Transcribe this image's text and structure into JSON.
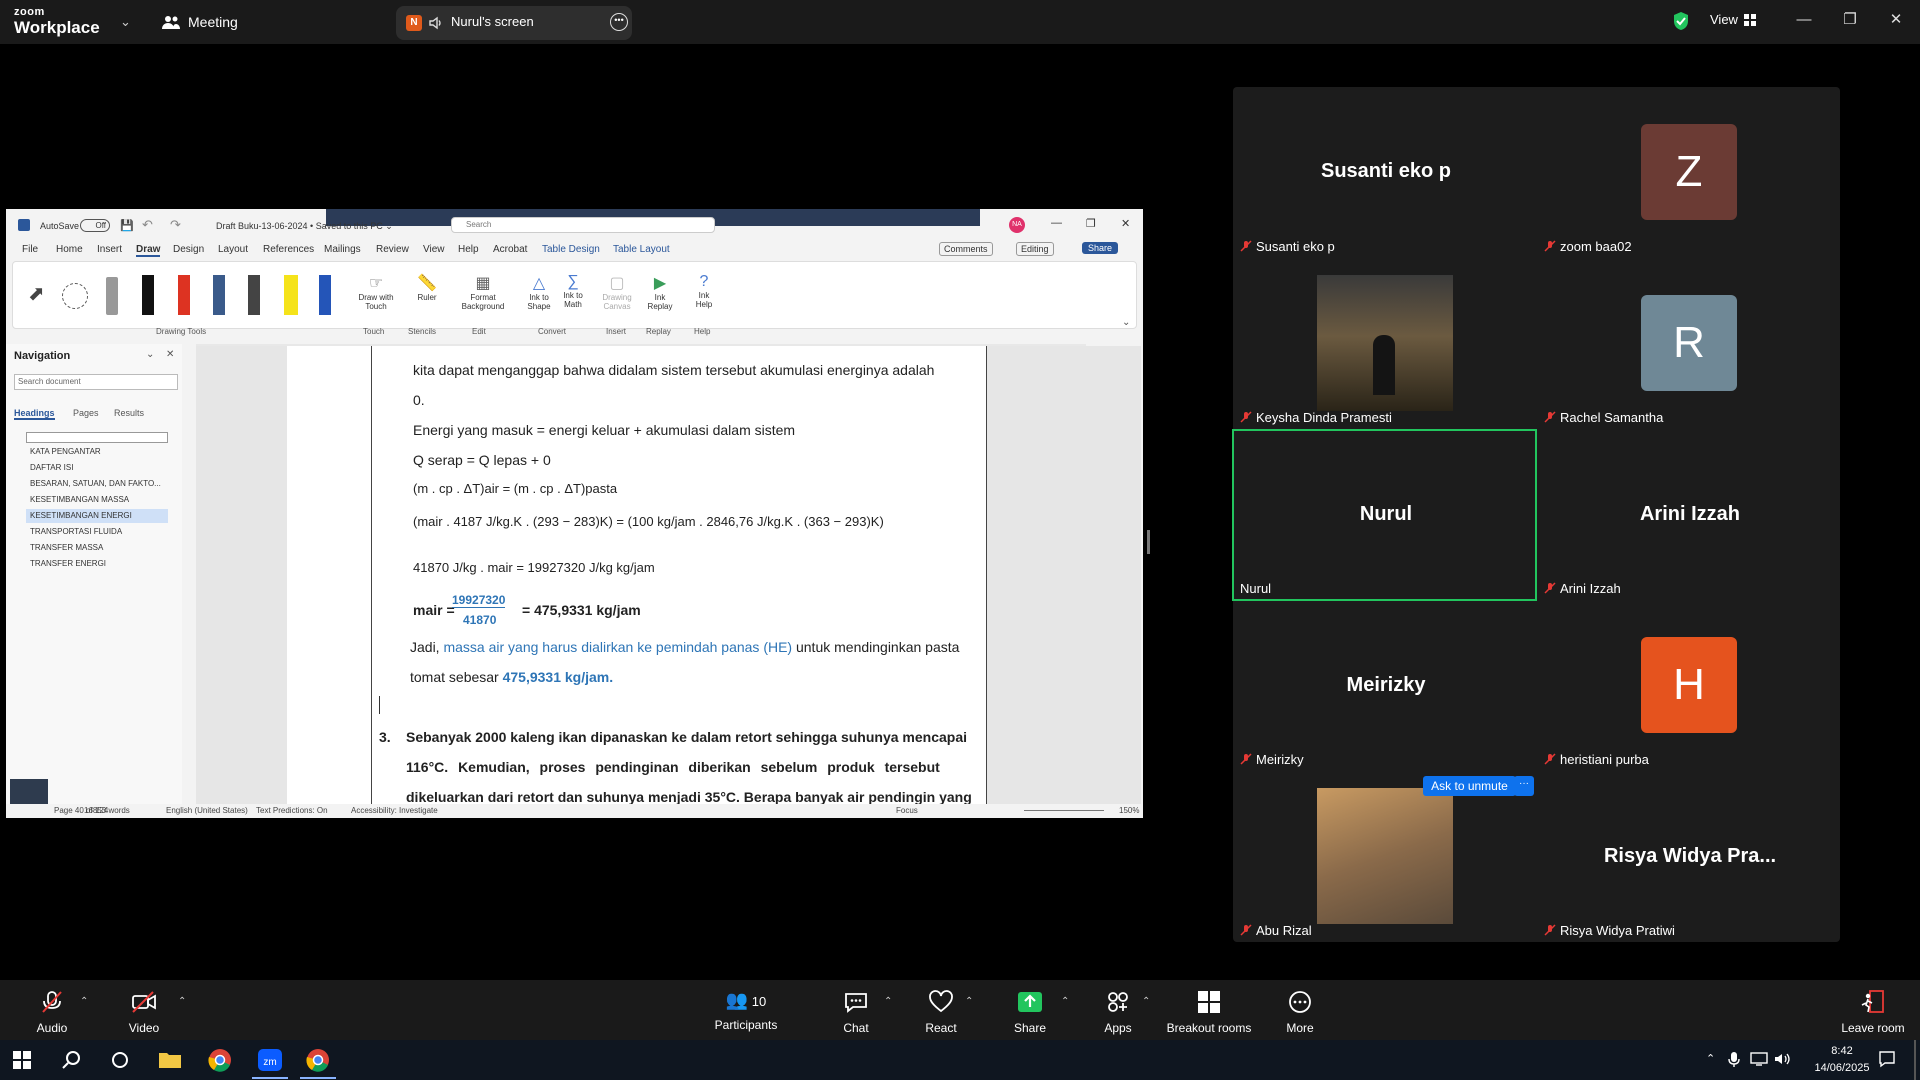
{
  "app": {
    "brand_top": "zoom",
    "brand_bottom": "Workplace",
    "meeting_label": "Meeting",
    "view_label": "View"
  },
  "share_pill": {
    "initial": "N",
    "label": "Nurul's screen"
  },
  "word": {
    "autosave_label": "AutoSave",
    "autosave_state": "Off",
    "doc_title": "Draft Buku-13-06-2024 • Saved to this PC ⌄",
    "search_placeholder": "Search",
    "user_initials": "NA",
    "tabs": [
      "File",
      "Home",
      "Insert",
      "Draw",
      "Design",
      "Layout",
      "References",
      "Mailings",
      "Review",
      "View",
      "Help",
      "Acrobat",
      "Table Design",
      "Table Layout"
    ],
    "comments_label": "Comments",
    "editing_label": "Editing",
    "share_label": "Share",
    "ribbon_groups": [
      {
        "label": "Drawing Tools"
      },
      {
        "label": "Touch",
        "items": [
          "Draw with\nTouch"
        ]
      },
      {
        "label": "Stencils",
        "items": [
          "Ruler"
        ]
      },
      {
        "label": "Edit",
        "items": [
          "Format\nBackground"
        ]
      },
      {
        "label": "Convert",
        "items": [
          "Ink to\nShape",
          "Ink to\nMath"
        ]
      },
      {
        "label": "Insert",
        "items": [
          "Drawing\nCanvas"
        ]
      },
      {
        "label": "Replay",
        "items": [
          "Ink\nReplay"
        ]
      },
      {
        "label": "Help",
        "items": [
          "Ink\nHelp"
        ]
      }
    ],
    "nav": {
      "title": "Navigation",
      "search_placeholder": "Search document",
      "tabs": [
        "Headings",
        "Pages",
        "Results"
      ],
      "items": [
        "KATA PENGANTAR",
        "DAFTAR ISI",
        "BESARAN, SATUAN, DAN FAKTO...",
        "KESETIMBANGAN MASSA",
        "KESETIMBANGAN ENERGI",
        "TRANSPORTASI FLUIDA",
        "TRANSFER MASSA",
        "TRANSFER ENERGI"
      ]
    },
    "body": {
      "line1": "kita dapat menganggap bahwa didalam sistem tersebut akumulasi energinya adalah",
      "line2": "0.",
      "line3": "Energi yang masuk = energi keluar + akumulasi dalam sistem",
      "eq1": "Q serap = Q lepas + 0",
      "eq2": "(m . cp . ΔT)air = (m . cp . ΔT)pasta",
      "eq3": "(mair . 4187 J/kg.K . (293 − 283)K) = (100 kg/jam . 2846,76 J/kg.K . (363 − 293)K)",
      "eq4": "41870 J/kg . mair = 19927320 J/kg kg/jam",
      "eq5_lhs": "mair =",
      "eq5_num": "19927320",
      "eq5_den": "41870",
      "eq5_rhs": "= 475,9331 kg/jam",
      "jadi1a": "Jadi, ",
      "jadi1b": "massa air yang harus dialirkan ke pemindah panas (HE)",
      "jadi1c": " untuk mendinginkan pasta",
      "jadi2a": "tomat sebesar ",
      "jadi2b": "475,9331 kg/jam.",
      "q3num": "3.",
      "q3l1": "Sebanyak 2000 kaleng ikan dipanaskan ke dalam retort sehingga suhunya mencapai",
      "q3l2": "116°C. Kemudian, proses pendinginan diberikan sebelum produk tersebut",
      "q3l3": "dikeluarkan dari retort dan suhunya menjadi 35°C. Berapa banyak air pendingin yang"
    },
    "status": {
      "page": "Page 40 of 124",
      "words": "16853 words",
      "lang": "English (United States)",
      "predict": "Text Predictions: On",
      "access": "Accessibility: Investigate",
      "focus": "Focus",
      "zoom": "150%"
    }
  },
  "participants": [
    {
      "display": "Susanti eko p",
      "label": "Susanti eko p",
      "muted": true
    },
    {
      "display": "Z",
      "label": "zoom baa02",
      "muted": true,
      "color": "#6b3b34"
    },
    {
      "display": "",
      "label": "Keysha Dinda Pramesti",
      "muted": true
    },
    {
      "display": "R",
      "label": "Rachel Samantha",
      "muted": true,
      "color": "#6f8896"
    },
    {
      "display": "Nurul",
      "label": "Nurul",
      "muted": false
    },
    {
      "display": "Arini Izzah",
      "label": "Arini Izzah",
      "muted": true
    },
    {
      "display": "Meirizky",
      "label": "Meirizky",
      "muted": true
    },
    {
      "display": "H",
      "label": "heristiani purba",
      "muted": true,
      "color": "#e5531e"
    },
    {
      "display": "",
      "label": "Abu Rizal",
      "muted": true
    },
    {
      "display": "Risya Widya Pra...",
      "label": "Risya Widya Pratiwi",
      "muted": true
    }
  ],
  "ask_unmute": "Ask to unmute",
  "toolbar": {
    "audio": "Audio",
    "video": "Video",
    "participants": "Participants",
    "participants_count": "10",
    "chat": "Chat",
    "react": "React",
    "share": "Share",
    "apps": "Apps",
    "breakout": "Breakout rooms",
    "more": "More",
    "leave": "Leave room"
  },
  "taskbar": {
    "time": "8:42",
    "date": "14/06/2025"
  },
  "colors": {
    "accent_green": "#22c55e",
    "share_green": "#22c55e",
    "word_blue": "#2e75b6",
    "zoom_bg": "#000000"
  }
}
